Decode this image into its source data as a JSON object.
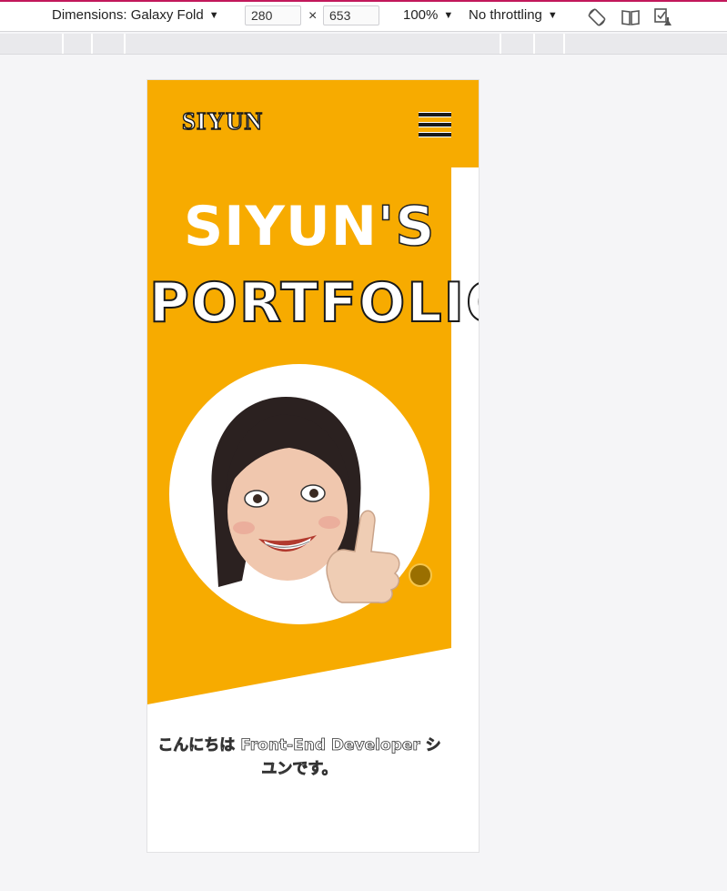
{
  "devtools": {
    "dimensions_label": "Dimensions: Galaxy Fold",
    "width_value": "280",
    "height_value": "653",
    "times_symbol": "×",
    "zoom_label": "100%",
    "throttling_label": "No throttling",
    "icons": [
      "rotate-icon",
      "dual-screen-icon",
      "device-posture-icon"
    ]
  },
  "site": {
    "logo": "SIYUN",
    "hero_title_line1": "SIYUN",
    "hero_title_apostrophe": "'S",
    "hero_title_line2": "PORTFOLIO",
    "intro_line1": "こんにちは Front-End Developer シ",
    "intro_line2": "ユンです。"
  },
  "colors": {
    "accent_yellow": "#f7ab00",
    "top_accent": "#c2185b",
    "scroll_dot": "#9a6f00"
  }
}
